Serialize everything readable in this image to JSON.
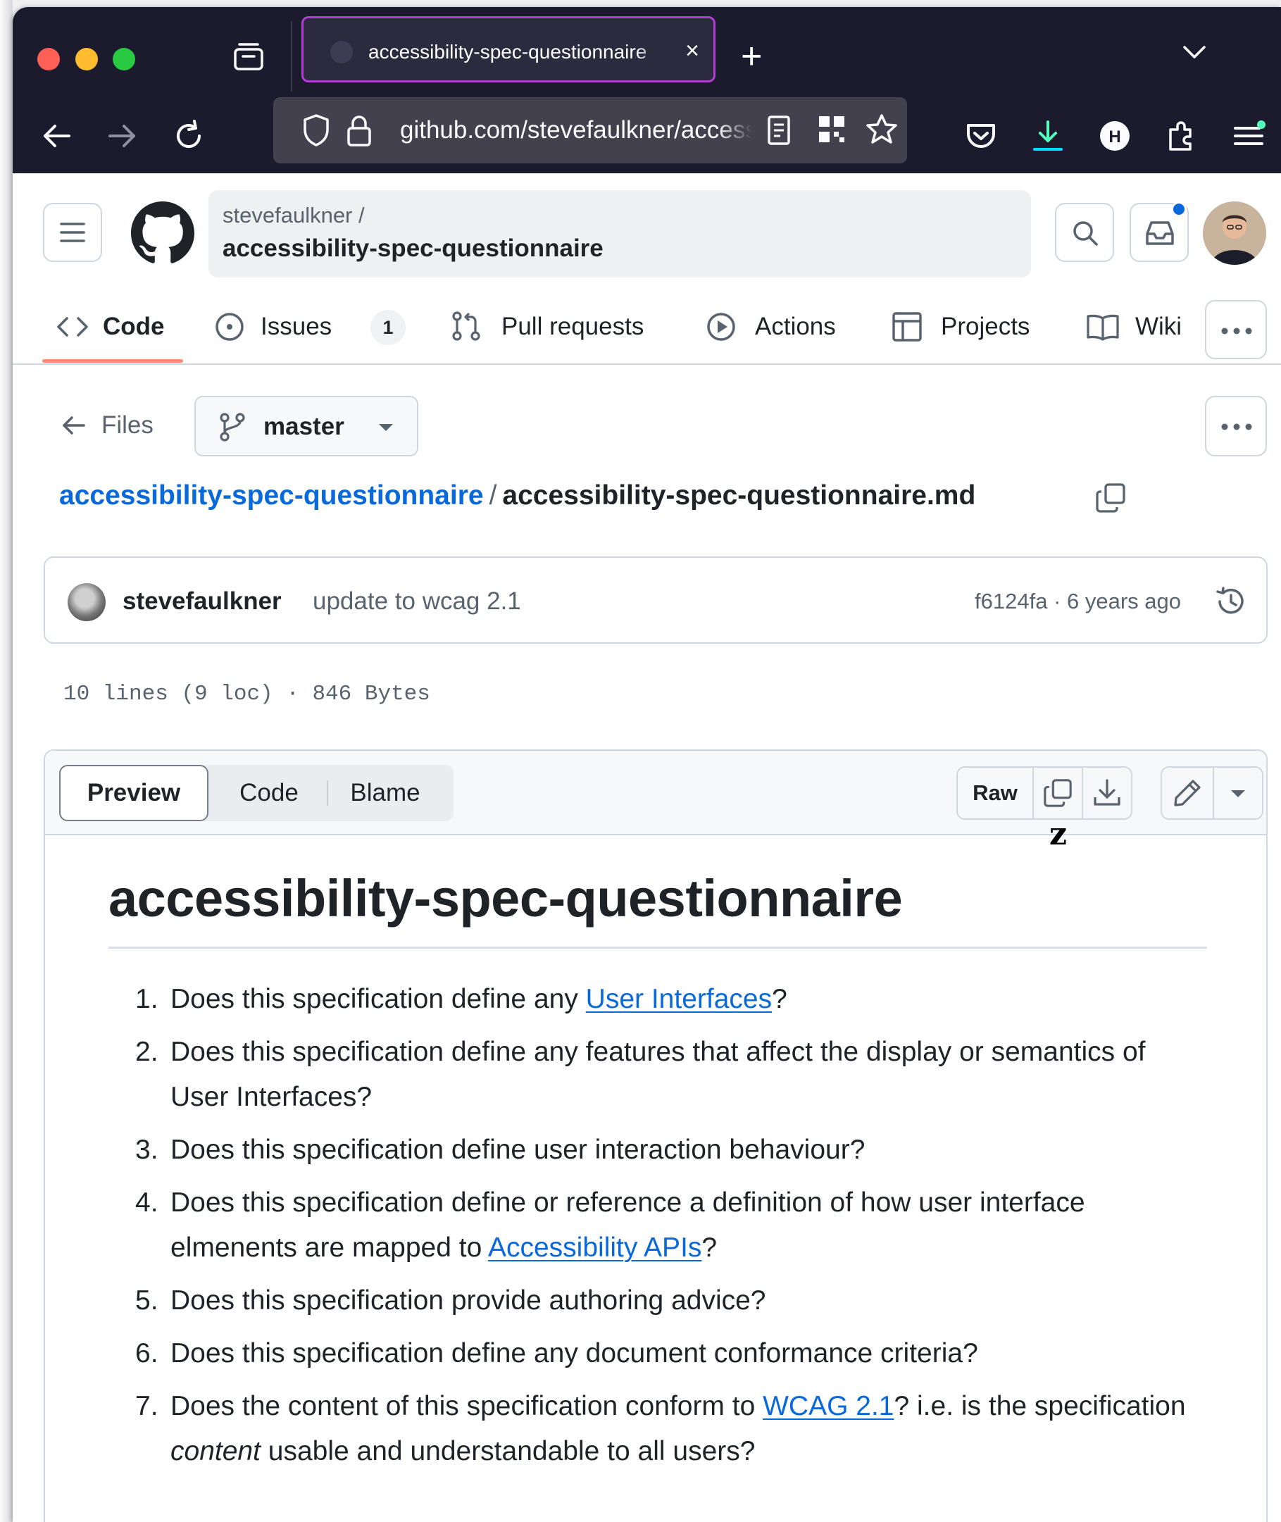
{
  "browser": {
    "tab": {
      "title": "accessibility-spec-questionnaire",
      "close_label": "×"
    },
    "new_tab_label": "+",
    "url": "github.com/stevefaulkner/accessibility-spec-questionnaire/blob/master/accessibility-spec-questionnaire.md",
    "toolbar_icons": [
      "pocket-icon",
      "download-icon",
      "honey-extension-icon",
      "extensions-icon",
      "app-menu-icon"
    ]
  },
  "github": {
    "owner": "stevefaulkner /",
    "repo": "accessibility-spec-questionnaire",
    "nav": {
      "code": "Code",
      "issues": "Issues",
      "issues_count": "1",
      "pulls": "Pull requests",
      "actions": "Actions",
      "projects": "Projects",
      "wiki": "Wiki"
    }
  },
  "file": {
    "files_label": "Files",
    "branch": "master",
    "path_repo": "accessibility-spec-questionnaire",
    "path_sep": "/",
    "path_file": "accessibility-spec-questionnaire.md",
    "commit": {
      "author": "stevefaulkner",
      "message": "update to wcag 2.1",
      "meta": "f6124fa · 6 years ago"
    },
    "info": "10 lines (9 loc) · 846 Bytes",
    "view_tabs": {
      "preview": "Preview",
      "code": "Code",
      "blame": "Blame"
    },
    "raw_label": "Raw"
  },
  "markdown": {
    "heading": "accessibility-spec-questionnaire",
    "items": [
      {
        "num": "1.",
        "before": "Does this specification define any ",
        "link": "User Interfaces",
        "after": "?"
      },
      {
        "num": "2.",
        "before": "Does this specification define any features that affect the display or semantics of User Interfaces?",
        "link": "",
        "after": ""
      },
      {
        "num": "3.",
        "before": "Does this specification define user interaction behaviour?",
        "link": "",
        "after": ""
      },
      {
        "num": "4.",
        "before": "Does this specification define or reference a definition of how user interface elmenents are mapped to ",
        "link": "Accessibility APIs",
        "after": "?"
      },
      {
        "num": "5.",
        "before": "Does this specification provide authoring advice?",
        "link": "",
        "after": ""
      },
      {
        "num": "6.",
        "before": "Does this specification define any document conformance criteria?",
        "link": "",
        "after": ""
      },
      {
        "num": "7.",
        "before": "Does the content of this specification conform to ",
        "link": "WCAG 2.1",
        "after": "? i.e. is the specification ",
        "em": "content",
        "tail": " usable and understandable to all users?"
      }
    ]
  },
  "overlay": {
    "cursor_glyph": "z"
  },
  "colors": {
    "accent": "#0969da",
    "tab_outline": "#b33bd6",
    "nav_underline": "#fd8c73",
    "chrome_bg": "#1c1b2e"
  }
}
